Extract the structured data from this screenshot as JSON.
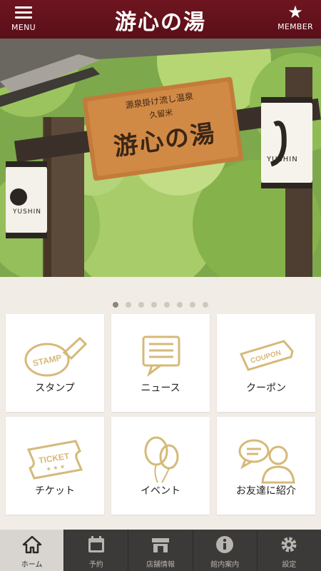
{
  "header": {
    "menu_label": "MENU",
    "logo_text": "游心の湯",
    "member_label": "MEMBER"
  },
  "hero": {
    "sign_line1": "源泉掛け流し温泉",
    "sign_line2": "久留米",
    "sign_main": "游心の湯",
    "lantern_text": "YUSHIN"
  },
  "carousel": {
    "total": 8,
    "active_index": 0
  },
  "tiles": [
    {
      "label": "スタンプ",
      "icon": "stamp-icon",
      "icon_text": "STAMP"
    },
    {
      "label": "ニュース",
      "icon": "news-icon"
    },
    {
      "label": "クーポン",
      "icon": "coupon-icon",
      "icon_text": "COUPON"
    },
    {
      "label": "チケット",
      "icon": "ticket-icon",
      "icon_text": "TICKET"
    },
    {
      "label": "イベント",
      "icon": "balloon-icon"
    },
    {
      "label": "お友達に紹介",
      "icon": "friends-icon"
    }
  ],
  "tabbar": [
    {
      "label": "ホーム",
      "icon": "home-icon",
      "active": true
    },
    {
      "label": "予約",
      "icon": "calendar-icon",
      "active": false
    },
    {
      "label": "店舗情報",
      "icon": "store-icon",
      "active": false
    },
    {
      "label": "館内案内",
      "icon": "info-icon",
      "active": false
    },
    {
      "label": "設定",
      "icon": "gear-icon",
      "active": false
    }
  ],
  "colors": {
    "header": "#6e1520",
    "icon_gold": "#d6b978",
    "tabbar": "#3c3a38",
    "tab_active": "#d8d4cf",
    "background": "#f1ece6"
  }
}
